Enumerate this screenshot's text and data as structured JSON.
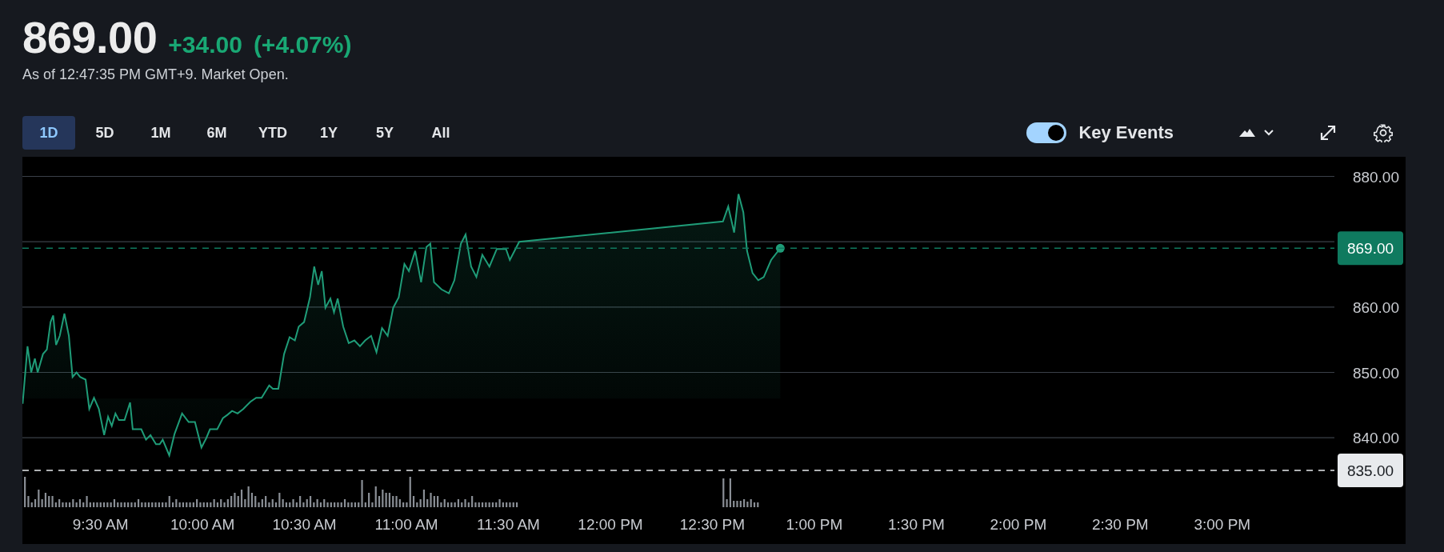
{
  "quote": {
    "price": "869.00",
    "change": "+34.00",
    "change_percent": "(+4.07%)",
    "as_of": "As of 12:47:35 PM GMT+9. Market Open."
  },
  "ranges": [
    {
      "label": "1D",
      "selected": true
    },
    {
      "label": "5D",
      "selected": false
    },
    {
      "label": "1M",
      "selected": false
    },
    {
      "label": "6M",
      "selected": false
    },
    {
      "label": "YTD",
      "selected": false
    },
    {
      "label": "1Y",
      "selected": false
    },
    {
      "label": "5Y",
      "selected": false
    },
    {
      "label": "All",
      "selected": false
    }
  ],
  "key_events": {
    "label": "Key Events",
    "on": true
  },
  "chart": {
    "chart_data": {
      "type": "area",
      "grid": true,
      "xlim": [
        9.117,
        15.55
      ],
      "ylim": [
        835,
        883
      ],
      "ref_lines": [
        {
          "axis": "y",
          "value": 869,
          "label": "869.00",
          "color": "#0f7a5f"
        },
        {
          "axis": "y",
          "value": 835,
          "label": "835.00",
          "color": "#e8eaed"
        }
      ],
      "xticks": [
        {
          "value": 9.5,
          "label": "9:30 AM"
        },
        {
          "value": 10,
          "label": "10:00 AM"
        },
        {
          "value": 10.5,
          "label": "10:30 AM"
        },
        {
          "value": 11,
          "label": "11:00 AM"
        },
        {
          "value": 11.5,
          "label": "11:30 AM"
        },
        {
          "value": 12,
          "label": "12:00 PM"
        },
        {
          "value": 12.5,
          "label": "12:30 PM"
        },
        {
          "value": 13,
          "label": "1:00 PM"
        },
        {
          "value": 13.5,
          "label": "1:30 PM"
        },
        {
          "value": 14,
          "label": "2:00 PM"
        },
        {
          "value": 14.5,
          "label": "2:30 PM"
        },
        {
          "value": 15,
          "label": "3:00 PM"
        }
      ],
      "yticks": [
        {
          "value": 840,
          "label": "840.00"
        },
        {
          "value": 850,
          "label": "850.00"
        },
        {
          "value": 860,
          "label": "860.00"
        },
        {
          "value": 880,
          "label": "880.00"
        }
      ],
      "x": [
        9.118,
        9.142,
        9.16,
        9.178,
        9.192,
        9.218,
        9.237,
        9.255,
        9.268,
        9.282,
        9.3,
        9.323,
        9.345,
        9.363,
        9.382,
        9.4,
        9.427,
        9.445,
        9.468,
        9.492,
        9.518,
        9.537,
        9.555,
        9.573,
        9.59,
        9.618,
        9.645,
        9.658,
        9.7,
        9.723,
        9.745,
        9.772,
        9.79,
        9.805,
        9.837,
        9.863,
        9.9,
        9.932,
        9.963,
        9.995,
        10.018,
        10.037,
        10.072,
        10.1,
        10.122,
        10.145,
        10.172,
        10.2,
        10.235,
        10.263,
        10.29,
        10.327,
        10.345,
        10.372,
        10.4,
        10.427,
        10.453,
        10.472,
        10.498,
        10.527,
        10.548,
        10.567,
        10.585,
        10.603,
        10.627,
        10.645,
        10.663,
        10.69,
        10.717,
        10.745,
        10.772,
        10.798,
        10.827,
        10.853,
        10.88,
        10.908,
        10.935,
        10.962,
        10.99,
        11.012,
        11.043,
        11.072,
        11.098,
        11.117,
        11.135,
        11.172,
        11.208,
        11.235,
        11.267,
        11.29,
        11.317,
        11.343,
        11.372,
        11.407,
        11.443,
        11.488,
        11.507,
        11.553,
        12.552,
        12.578,
        12.607,
        12.628,
        12.652,
        12.67,
        12.697,
        12.725,
        12.752,
        12.788,
        12.833
      ],
      "series": [
        {
          "color": "#1f9c78",
          "values": [
            845.2,
            854.0,
            850.0,
            852.1,
            850.0,
            852.8,
            853.5,
            857.7,
            858.7,
            854.2,
            855.6,
            859.0,
            855.6,
            849.3,
            850.0,
            849.3,
            848.9,
            844.4,
            846.1,
            844.4,
            840.4,
            843.2,
            841.8,
            843.7,
            842.7,
            842.7,
            845.4,
            841.3,
            841.3,
            839.7,
            840.4,
            839.0,
            839.0,
            839.7,
            837.3,
            840.6,
            843.7,
            842.4,
            842.4,
            838.5,
            839.9,
            841.3,
            841.3,
            843.0,
            843.5,
            844.1,
            843.7,
            844.4,
            845.5,
            846.1,
            846.1,
            848.0,
            847.5,
            847.5,
            852.8,
            855.4,
            854.9,
            857.0,
            857.7,
            861.5,
            866.2,
            863.4,
            865.5,
            859.9,
            861.3,
            859.2,
            861.3,
            857.0,
            854.5,
            854.9,
            854.0,
            854.9,
            855.6,
            853.1,
            856.8,
            855.6,
            859.9,
            861.5,
            866.6,
            865.5,
            868.6,
            863.8,
            869.2,
            869.7,
            863.8,
            862.7,
            862.1,
            864.1,
            869.7,
            871.1,
            866.2,
            864.6,
            868.0,
            866.2,
            868.9,
            868.9,
            867.2,
            870.0,
            873.1,
            875.4,
            871.4,
            877.3,
            874.5,
            868.6,
            865.2,
            864.1,
            864.6,
            867.2,
            869.0
          ]
        }
      ]
    }
  }
}
